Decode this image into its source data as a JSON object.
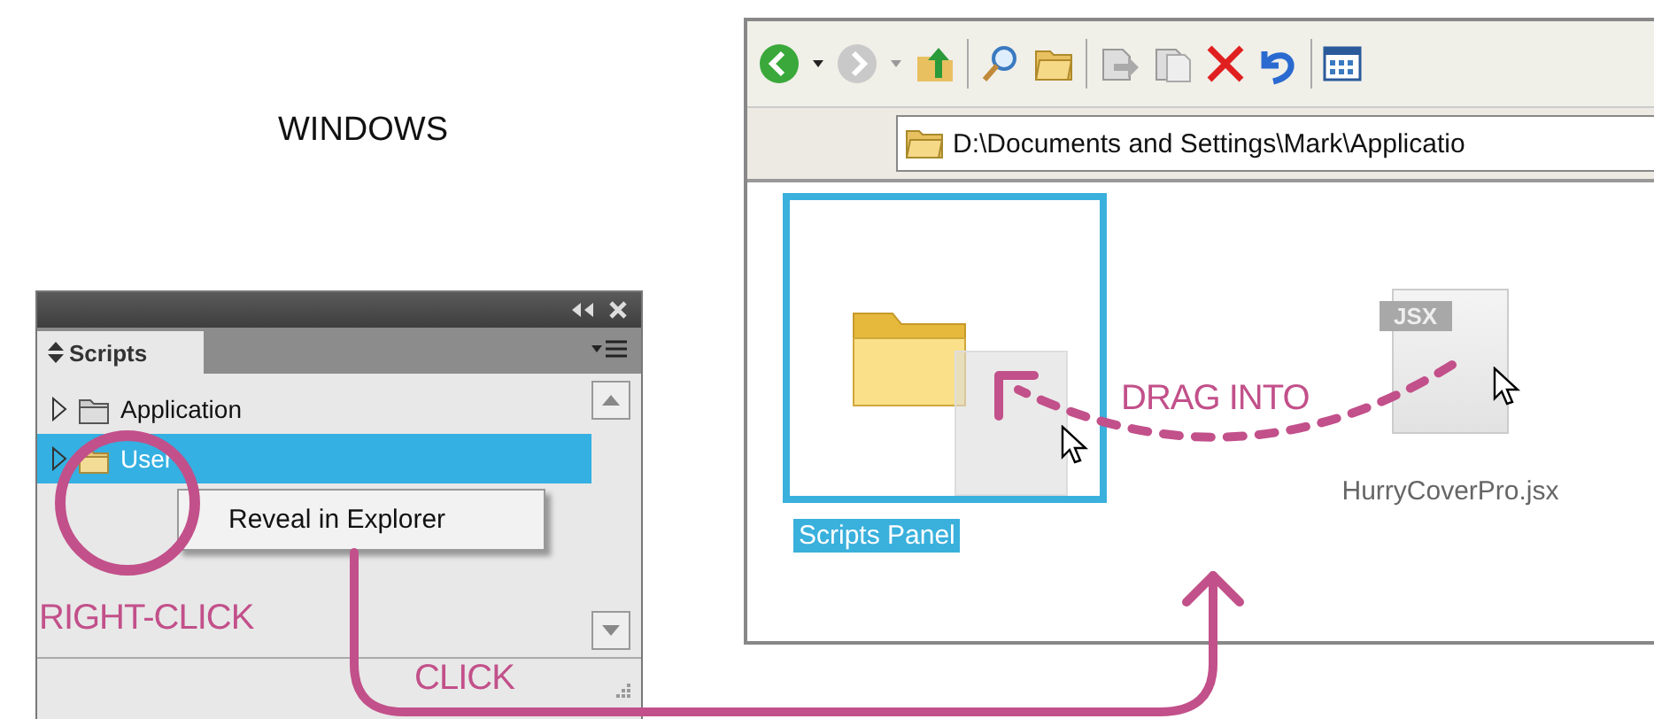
{
  "heading": "WINDOWS",
  "scripts_panel": {
    "tab": "Scripts",
    "items": [
      {
        "label": "Application",
        "kind": "plain",
        "selected": false
      },
      {
        "label": "User",
        "kind": "yellow",
        "selected": true
      }
    ],
    "context_menu": [
      "Reveal in Explorer"
    ]
  },
  "explorer": {
    "address": "D:\\Documents and Settings\\Mark\\Applicatio",
    "items": [
      {
        "label": "Scripts Panel",
        "kind": "folder",
        "selected": true
      },
      {
        "label": "HurryCoverPro.jsx",
        "kind": "file",
        "badge": "JSX",
        "selected": false
      }
    ]
  },
  "annotations": [
    {
      "text": "RIGHT-CLICK",
      "kind": "rightclick"
    },
    {
      "text": "CLICK",
      "kind": "click"
    },
    {
      "text": "DRAG INTO",
      "kind": "drag"
    }
  ]
}
